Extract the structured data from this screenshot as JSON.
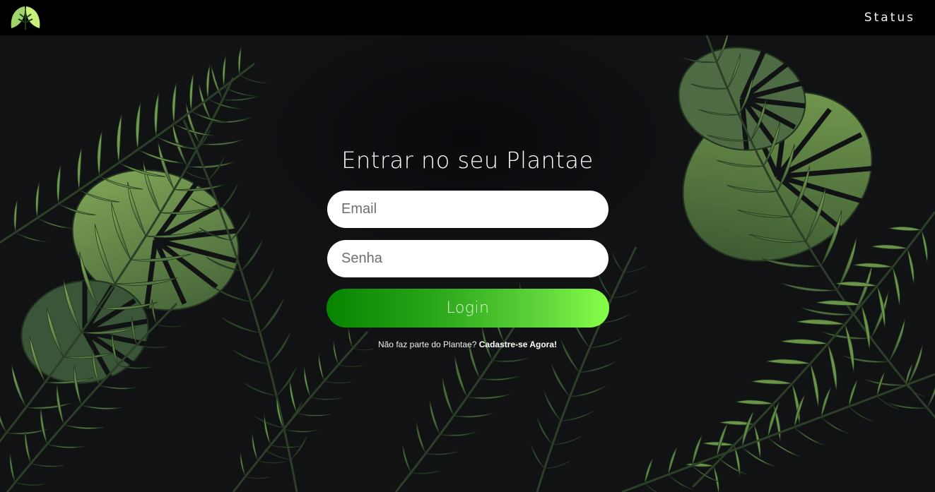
{
  "header": {
    "logo_icon": "leaf-logo-icon",
    "status_label": "Status"
  },
  "login": {
    "title": "Entrar no seu Plantae",
    "email_placeholder": "Email",
    "password_placeholder": "Senha",
    "login_label": "Login",
    "signup_prompt": "Não faz parte do Plantae?",
    "signup_link": "Cadastre-se Agora!"
  },
  "colors": {
    "header_bg": "#000000",
    "leaf_light": "#7fa957",
    "leaf_dark": "#3f5a36",
    "button_gradient_start": "#078400",
    "button_gradient_end": "#85ff48"
  }
}
